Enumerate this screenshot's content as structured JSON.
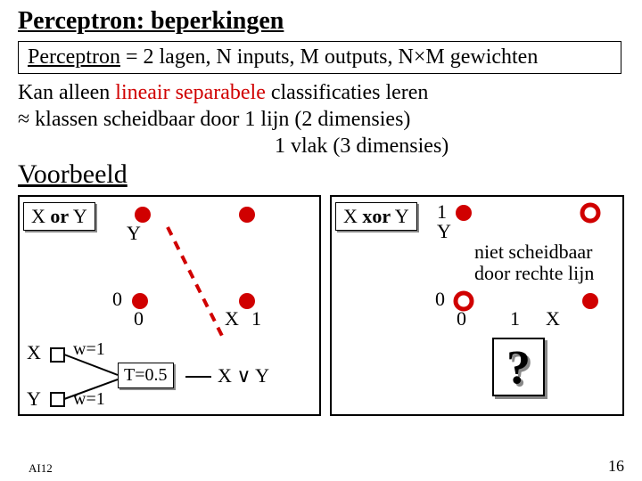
{
  "title": "Perceptron: beperkingen",
  "formula": {
    "prefix": "Perceptron",
    "rest": " = 2 lagen, N inputs, M outputs, N×M gewichten"
  },
  "body": {
    "line1_pre": "Kan alleen ",
    "line1_red": "lineair separabele",
    "line1_post": " classificaties leren",
    "line2": "≈ klassen scheidbaar door 1 lijn (2 dimensies)",
    "line3": "1 vlak (3 dimensies)"
  },
  "voorbeeld": "Voorbeeld",
  "left": {
    "title_pre": "X ",
    "title_op": "or",
    "title_post": " Y",
    "Y": "Y",
    "zeroY": "0",
    "zeroX": "0",
    "X": "X",
    "one": "1",
    "X_in": "X",
    "Y_in": "Y",
    "w1": "w=1",
    "w2": "w=1",
    "T": "T=0.5",
    "out": "X ∨ Y"
  },
  "right": {
    "title_pre": "X ",
    "title_op": "xor",
    "title_post": " Y",
    "one_top": "1",
    "Y": "Y",
    "note1": "niet scheidbaar",
    "note2": "door rechte lijn",
    "zeroY": "0",
    "zeroX": "0",
    "oneX": "1",
    "X": "X",
    "q": "?"
  },
  "footer": {
    "ai": "AI12",
    "page": "16"
  }
}
